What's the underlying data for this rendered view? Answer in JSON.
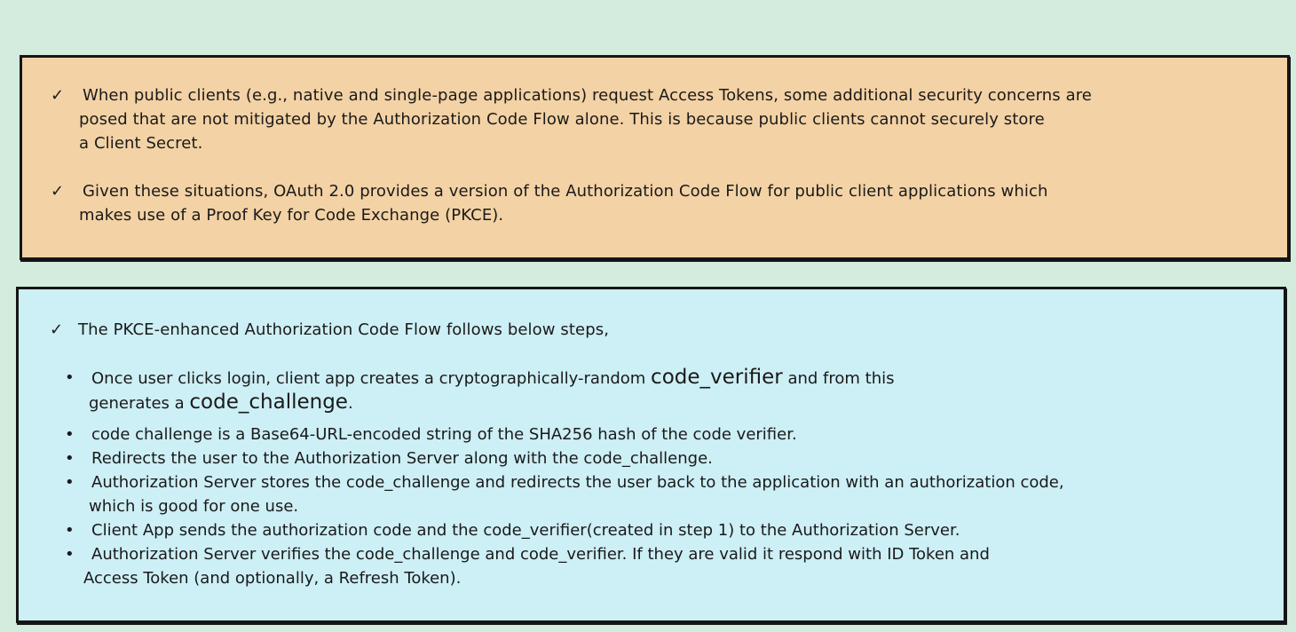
{
  "top_panel": {
    "check_mark": "✓",
    "item1": {
      "line1": "When public clients (e.g., native and single-page applications) request Access Tokens, some additional security concerns are",
      "line2": "posed that are not mitigated by the Authorization Code Flow alone. This is because public clients cannot securely store",
      "line3": "a Client Secret."
    },
    "item2": {
      "line1": "Given these situations, OAuth 2.0 provides a version of the Authorization Code Flow for public client applications which",
      "line2": "makes use of a Proof Key for Code Exchange (PKCE)."
    }
  },
  "bottom_panel": {
    "check_mark": "✓",
    "intro": "The PKCE-enhanced Authorization Code Flow follows below steps,",
    "bullet_symbol": "•",
    "step1": {
      "pre": "Once user clicks login, client app creates a cryptographically-random ",
      "term1": "code_verifier",
      "mid": " and from this",
      "line2_pre": "generates a ",
      "term2": "code_challenge",
      "line2_post": "."
    },
    "step2": "code challenge is a Base64-URL-encoded string of the SHA256 hash of the code verifier.",
    "step3": "Redirects the user to the Authorization Server along with the code_challenge.",
    "step4": {
      "line1": "Authorization Server stores the code_challenge and redirects the user back to the application with an authorization code,",
      "line2": "which is good for one use."
    },
    "step5": "Client App sends the authorization code and the code_verifier(created in step 1) to the Authorization Server.",
    "step6": {
      "line1": "Authorization Server verifies the code_challenge and code_verifier. If they are valid it respond with ID Token and",
      "line2": "Access Token (and optionally, a Refresh Token)."
    }
  }
}
